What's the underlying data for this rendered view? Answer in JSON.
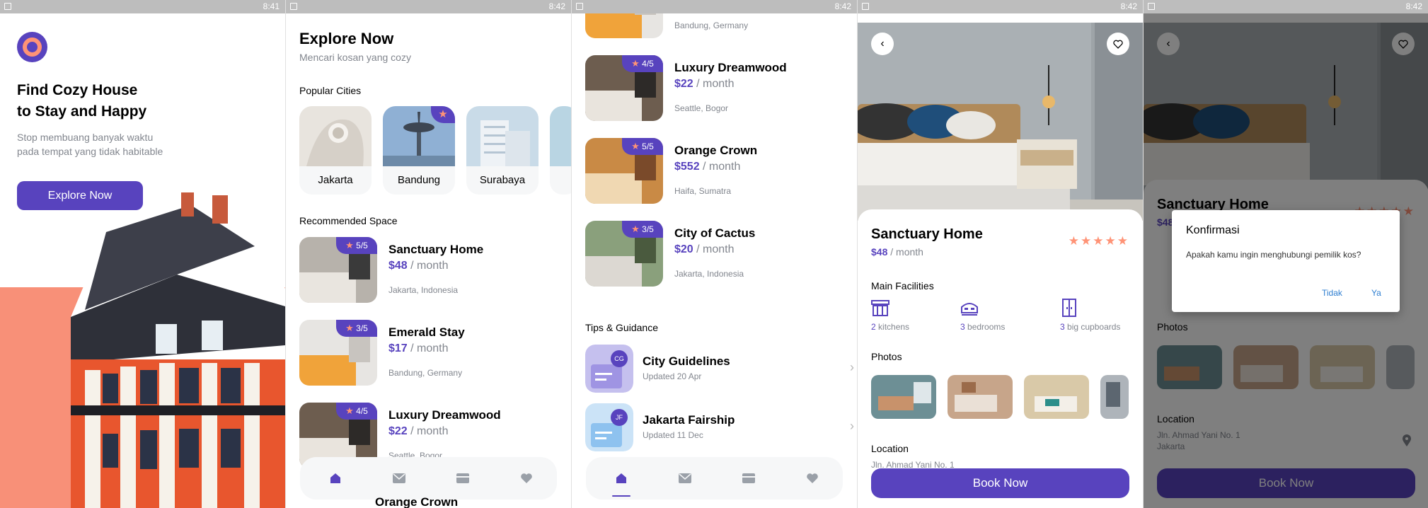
{
  "status_bar": {
    "times": [
      "8:41",
      "8:42",
      "8:42",
      "8:42",
      "8:42"
    ]
  },
  "splash": {
    "title_line1": "Find Cozy House",
    "title_line2": "to Stay and Happy",
    "subtitle_line1": "Stop membuang banyak waktu",
    "subtitle_line2": "pada tempat yang tidak habitable",
    "cta_label": "Explore Now"
  },
  "explore": {
    "title": "Explore Now",
    "subtitle": "Mencari kosan yang cozy",
    "popular_label": "Popular Cities",
    "cities": [
      {
        "name": "Jakarta",
        "popular": false
      },
      {
        "name": "Bandung",
        "popular": true
      },
      {
        "name": "Surabaya",
        "popular": false
      }
    ],
    "recommended_label": "Recommended Space",
    "rooms": [
      {
        "name": "Sanctuary Home",
        "price": "$48",
        "per": " / month",
        "location": "Jakarta, Indonesia",
        "rating": "5/5"
      },
      {
        "name": "Emerald Stay",
        "price": "$17",
        "per": " / month",
        "location": "Bandung, Germany",
        "rating": "3/5"
      },
      {
        "name": "Luxury Dreamwood",
        "price": "$22",
        "per": " / month",
        "location": "Seattle, Bogor",
        "rating": "4/5"
      },
      {
        "name": "Orange Crown",
        "price": "$552",
        "per": " / month",
        "location": "Haifa, Sumatra",
        "rating": "5/5"
      },
      {
        "name": "City of Cactus",
        "price": "$20",
        "per": " / month",
        "location": "Jakarta, Indonesia",
        "rating": "3/5"
      }
    ],
    "tips_label": "Tips & Guidance",
    "tips": [
      {
        "title": "City Guidelines",
        "date": "Updated 20 Apr",
        "badge": "CG"
      },
      {
        "title": "Jakarta Fairship",
        "date": "Updated 11 Dec",
        "badge": "JF"
      }
    ]
  },
  "detail": {
    "name": "Sanctuary Home",
    "price": "$48",
    "per": " / month",
    "rating_stars": 5,
    "facilities_label": "Main Facilities",
    "facilities": [
      {
        "count": "2",
        "label": " kitchens"
      },
      {
        "count": "3",
        "label": " bedrooms"
      },
      {
        "count": "3",
        "label": " big cupboards"
      }
    ],
    "photos_label": "Photos",
    "location_label": "Location",
    "address_line1": "Jln. Ahmad Yani No. 1",
    "address_line2": "Jakarta",
    "book_label": "Book Now"
  },
  "dialog": {
    "title": "Konfirmasi",
    "message": "Apakah kamu ingin menghubungi pemilik kos?",
    "cancel": "Tidak",
    "confirm": "Ya"
  },
  "colors": {
    "primary": "#5843be",
    "accent": "#ff9376",
    "grey": "#82868e",
    "light": "#f6f7f8"
  }
}
